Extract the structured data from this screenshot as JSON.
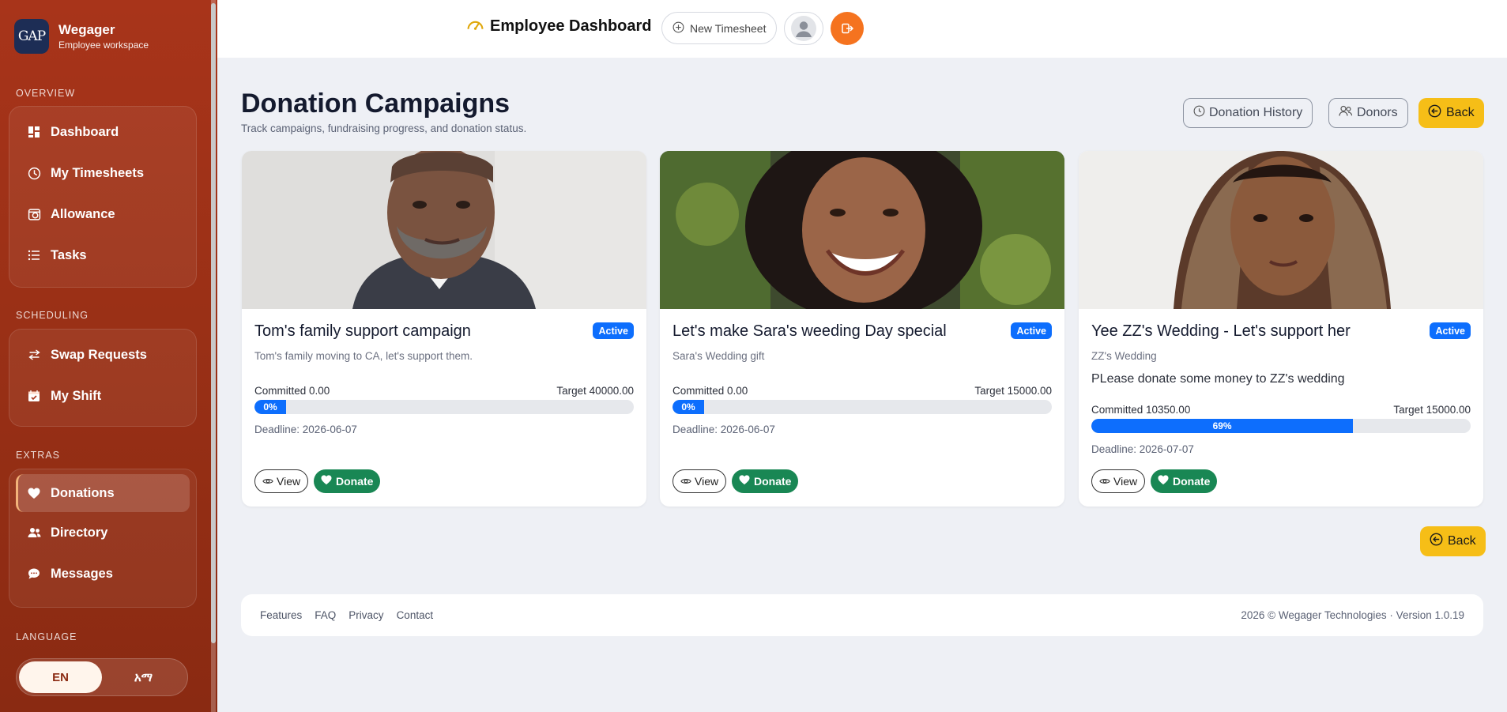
{
  "app": {
    "name": "Wegager",
    "subtitle": "Employee workspace",
    "logo_text": "GAP"
  },
  "sidebar": {
    "sections": [
      {
        "label": "OVERVIEW",
        "items": [
          {
            "label": "Dashboard",
            "icon": "dashboard-icon"
          },
          {
            "label": "My Timesheets",
            "icon": "clock-icon"
          },
          {
            "label": "Allowance",
            "icon": "allowance-icon"
          },
          {
            "label": "Tasks",
            "icon": "list-icon"
          }
        ]
      },
      {
        "label": "SCHEDULING",
        "items": [
          {
            "label": "Swap Requests",
            "icon": "swap-icon"
          },
          {
            "label": "My Shift",
            "icon": "calendar-check-icon"
          }
        ]
      },
      {
        "label": "EXTRAS",
        "items": [
          {
            "label": "Donations",
            "icon": "heart-icon",
            "active": true
          },
          {
            "label": "Directory",
            "icon": "people-icon"
          },
          {
            "label": "Messages",
            "icon": "chat-icon"
          }
        ]
      }
    ],
    "language": {
      "label": "LANGUAGE",
      "options": [
        "EN",
        "አማ"
      ],
      "selected": "EN"
    }
  },
  "topbar": {
    "title": "Employee Dashboard",
    "new_timesheet_label": "New Timesheet"
  },
  "page": {
    "title": "Donation Campaigns",
    "subtitle": "Track campaigns, fundraising progress, and donation status.",
    "donation_history_label": "Donation History",
    "donors_label": "Donors",
    "back_label": "Back"
  },
  "campaigns": [
    {
      "title": "Tom's family support campaign",
      "status": "Active",
      "subtitle": "Tom's family moving to CA, let's support them.",
      "description": "",
      "committed": "Committed 0.00",
      "target": "Target 40000.00",
      "progress": 0,
      "progress_label": "0%",
      "deadline": "Deadline: 2026-06-07",
      "view_label": "View",
      "donate_label": "Donate"
    },
    {
      "title": "Let's make Sara's weeding Day special",
      "status": "Active",
      "subtitle": "Sara's Wedding gift",
      "description": "",
      "committed": "Committed 0.00",
      "target": "Target 15000.00",
      "progress": 0,
      "progress_label": "0%",
      "deadline": "Deadline: 2026-06-07",
      "view_label": "View",
      "donate_label": "Donate"
    },
    {
      "title": "Yee ZZ's Wedding - Let's support her",
      "status": "Active",
      "subtitle": "ZZ's Wedding",
      "description": "PLease donate some money to ZZ's wedding",
      "committed": "Committed 10350.00",
      "target": "Target 15000.00",
      "progress": 69,
      "progress_label": "69%",
      "deadline": "Deadline: 2026-07-07",
      "view_label": "View",
      "donate_label": "Donate"
    }
  ],
  "footer": {
    "links": [
      "Features",
      "FAQ",
      "Privacy",
      "Contact"
    ],
    "copyright": "2026 © Wegager Technologies · Version 1.0.19"
  },
  "colors": {
    "sidebar": "#a8341a",
    "accent_orange": "#f5731f",
    "back_yellow": "#f6be17",
    "primary_blue": "#0d6efd",
    "donate_green": "#198754"
  }
}
